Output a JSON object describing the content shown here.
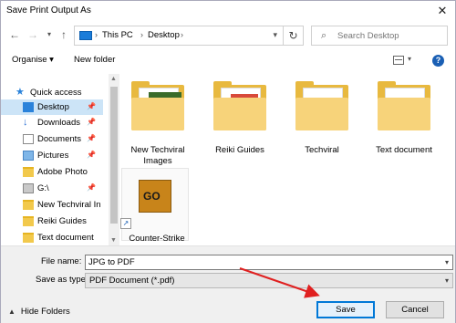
{
  "window": {
    "title": "Save Print Output As",
    "close_label": "✕"
  },
  "address": {
    "crumbs": [
      "This PC",
      "Desktop"
    ],
    "separator": "›",
    "search_placeholder": "Search Desktop"
  },
  "toolbar": {
    "organise_label": "Organise ▾",
    "new_folder_label": "New folder",
    "help_label": "?"
  },
  "sidebar": {
    "items": [
      {
        "label": "Quick access",
        "icon": "star-icon",
        "pinned": false
      },
      {
        "label": "Desktop",
        "icon": "desktop-icon",
        "pinned": true,
        "selected": true
      },
      {
        "label": "Downloads",
        "icon": "downloads-icon",
        "pinned": true
      },
      {
        "label": "Documents",
        "icon": "documents-icon",
        "pinned": true
      },
      {
        "label": "Pictures",
        "icon": "pictures-icon",
        "pinned": true
      },
      {
        "label": "Adobe Photo",
        "icon": "folder-icon",
        "pinned": false
      },
      {
        "label": "G:\\",
        "icon": "drive-icon",
        "pinned": true
      },
      {
        "label": "New Techviral In",
        "icon": "folder-icon",
        "pinned": false
      },
      {
        "label": "Reiki Guides",
        "icon": "folder-icon",
        "pinned": false
      },
      {
        "label": "Text document",
        "icon": "folder-icon",
        "pinned": false
      }
    ]
  },
  "files": [
    {
      "name": "New Techviral Images",
      "type": "folder-image"
    },
    {
      "name": "Reiki Guides",
      "type": "folder-pdf"
    },
    {
      "name": "Techviral",
      "type": "folder"
    },
    {
      "name": "Text document",
      "type": "folder"
    },
    {
      "name": "Counter-Strike",
      "type": "shortcut",
      "thumb_text": "GO"
    }
  ],
  "form": {
    "file_name_label": "File name:",
    "file_name_value": "JPG to PDF",
    "save_type_label": "Save as type:",
    "save_type_value": "PDF Document (*.pdf)"
  },
  "footer": {
    "hide_folders_label": "Hide Folders",
    "save_label": "Save",
    "cancel_label": "Cancel"
  },
  "colors": {
    "accent": "#0078d7",
    "selection": "#cce4f7",
    "folder": "#e8b93f",
    "annotation_arrow": "#e02020"
  }
}
